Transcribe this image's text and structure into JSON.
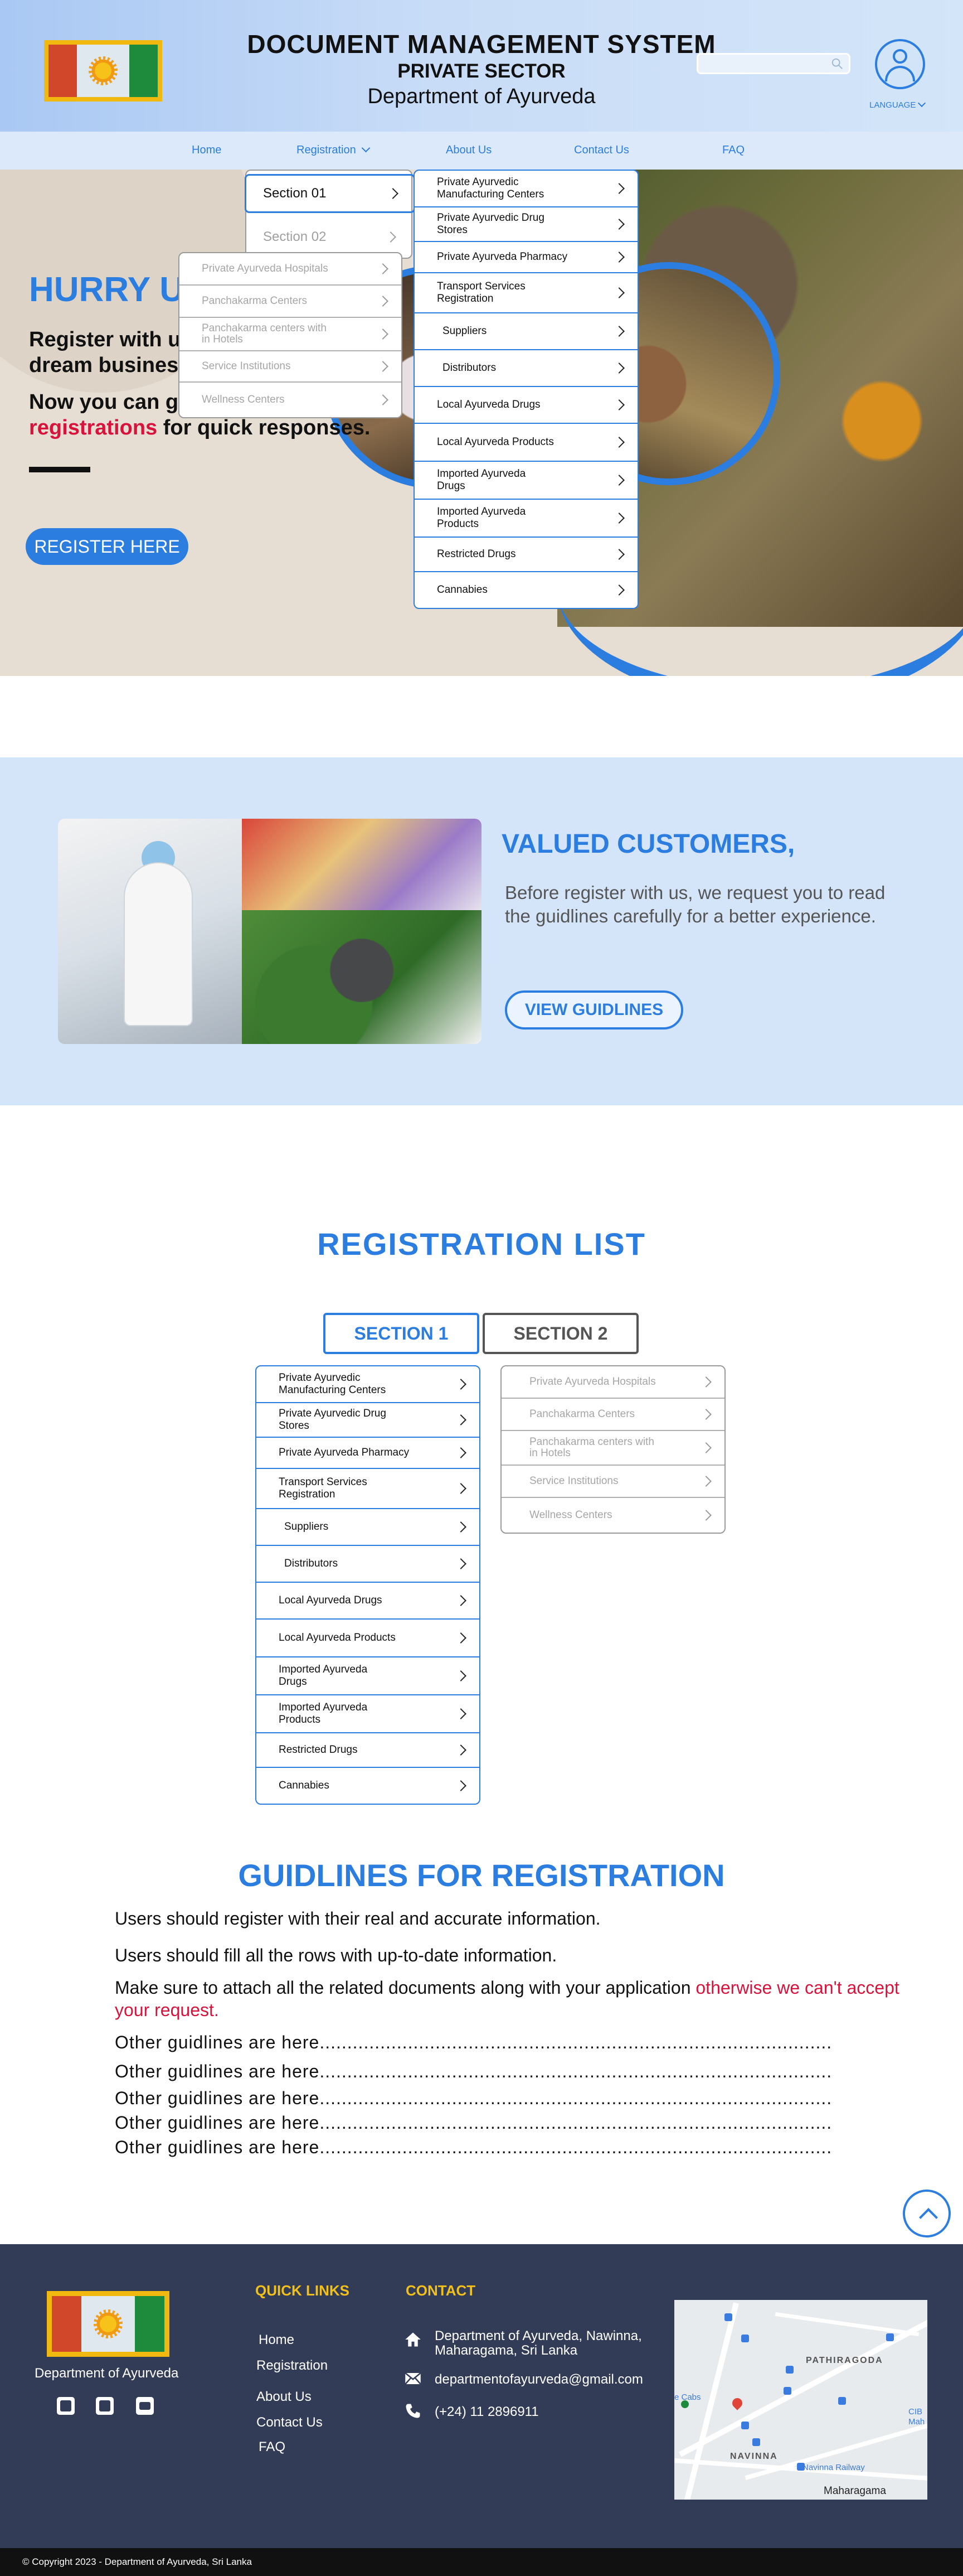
{
  "header": {
    "title": "DOCUMENT  MANAGEMENT  SYSTEM",
    "subtitle": "PRIVATE SECTOR",
    "department": "Department of Ayurveda",
    "search": {
      "placeholder": "",
      "value": ""
    },
    "language_label": "LANGUAGE"
  },
  "nav": {
    "items": [
      "Home",
      "Registration",
      "About Us",
      "Contact Us",
      "FAQ"
    ]
  },
  "hero": {
    "heading": "HURRY U",
    "text1": "Register with us",
    "text1b": "dream business",
    "text2a": "Now you can ge",
    "text2_red": "registrations",
    "text2b": " for quick responses.",
    "button": "REGISTER HERE"
  },
  "section_menu": {
    "items": [
      "Section 01",
      "Section 02"
    ]
  },
  "section1_items": [
    "Private Ayurvedic Manufacturing Centers",
    "Private Ayurvedic Drug Stores",
    "Private Ayurveda Pharmacy",
    "Transport Services Registration",
    "Suppliers",
    "Distributors",
    "Local Ayurveda Drugs",
    "Local Ayurveda Products",
    "Imported Ayurveda Drugs",
    "Imported Ayurveda Products",
    "Restricted Drugs",
    "Cannabies"
  ],
  "section2_items": [
    "Private Ayurveda Hospitals",
    "Panchakarma Centers",
    "Panchakarma centers with in Hotels",
    "Service Institutions",
    "Wellness Centers"
  ],
  "customers": {
    "heading": "VALUED CUSTOMERS,",
    "text": "Before register with us, we request you to read the guidlines carefully for a better experience.",
    "button": "VIEW GUIDLINES"
  },
  "registration_list": {
    "heading": "REGISTRATION  LIST",
    "tabs": [
      "SECTION 1",
      "SECTION 2"
    ]
  },
  "guidelines": {
    "heading": "GUIDLINES FOR REGISTRATION",
    "line1": "Users should register with their real and accurate information.",
    "line2": "Users should fill all the rows with up-to-date information.",
    "line3a": "Make sure to attach all the related documents along with your application ",
    "line3_red": "otherwise we can't accept your request.",
    "other": "Other guidlines are here............................................................................................."
  },
  "footer": {
    "department": "Department of Ayurveda",
    "quick_links_heading": "QUICK LINKS",
    "quick_links": [
      "Home",
      "Registration",
      "About Us",
      "Contact Us",
      "FAQ"
    ],
    "contact_heading": "CONTACT",
    "address": "Department of Ayurveda, Nawinna, Maharagama, Sri Lanka",
    "email": "departmentofayurveda@gmail.com",
    "phone": "(+24) 11 2896911",
    "map_labels": {
      "area1": "PATHIRAGODA",
      "area2": "NAVINNA",
      "area3": "Maharagama",
      "railway": "Navinna Railway",
      "cabs": "e Cabs",
      "cib": "CIB",
      "cib2": "Mah"
    },
    "copyright": "© Copyright 2023 - Department of Ayurveda, Sri Lanka"
  },
  "colors": {
    "accent": "#2b7de0",
    "red": "#d8123a",
    "footer": "#323c57",
    "gold": "#f1c01b"
  }
}
